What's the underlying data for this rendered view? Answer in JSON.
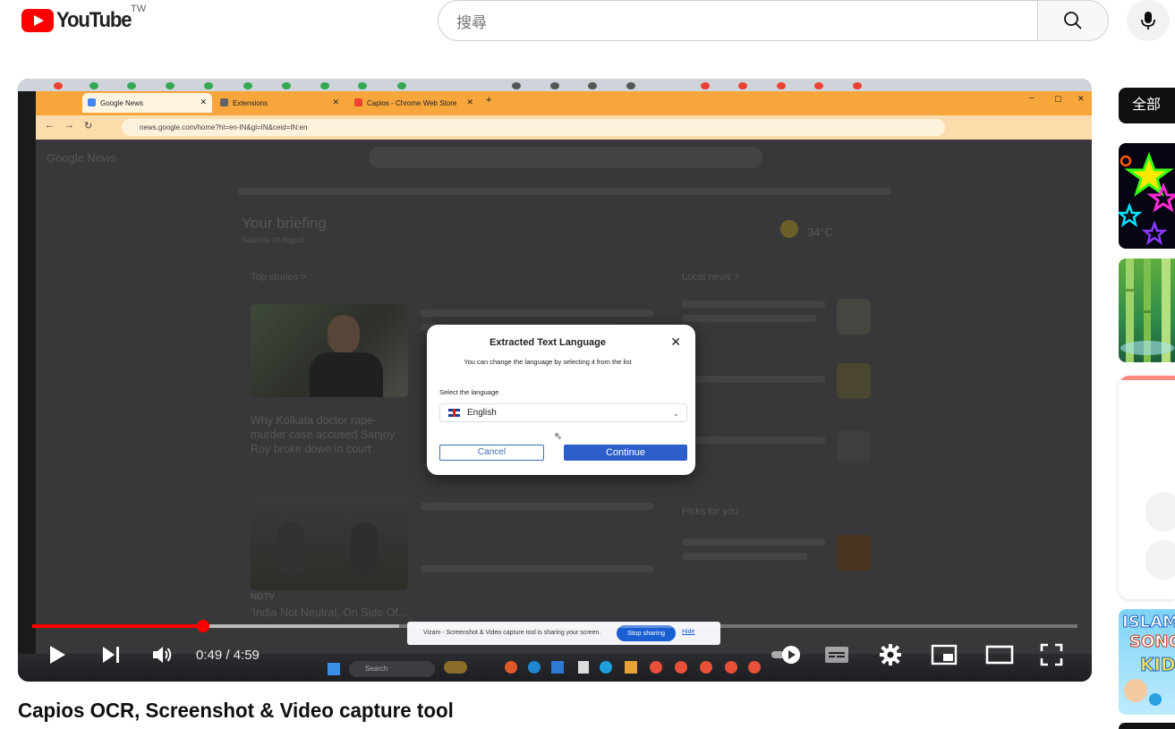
{
  "header": {
    "logo_word": "YouTube",
    "region": "TW",
    "search_placeholder": "搜尋"
  },
  "player": {
    "current_time": "0:49",
    "duration": "4:59",
    "time_separator": " / ",
    "progress_fraction": 0.1637,
    "time_display": "0:49 / 4:59"
  },
  "recording": {
    "tabs": [
      {
        "label": "Google News"
      },
      {
        "label": "Extensions"
      },
      {
        "label": "Capios - Chrome Web Store"
      }
    ],
    "address": "news.google.com/home?hl=en-IN&gl=IN&ceid=IN:en",
    "site_logo": "Google News",
    "briefing_title": "Your briefing",
    "briefing_date": "Saturday 24 August",
    "top_stories": "Top stories >",
    "local_news": "Local news >",
    "picks_for_you": "Picks for you",
    "weather_temp": "34°C",
    "story_1": "Why Kolkata doctor rape-murder case accused Sanjoy Roy broke down in court",
    "story_2_source": "NDTV",
    "story_2": "'India Not Neutral, On Side Of...",
    "modal": {
      "title": "Extracted Text Language",
      "subtitle": "You can change the language by selecting it from the list",
      "select_label": "Select the language",
      "selected_language": "English",
      "cancel": "Cancel",
      "continue": "Continue"
    },
    "sharebar": {
      "message": "Vizam - Screenshot & Video capture tool is sharing your screen.",
      "stop": "Stop sharing",
      "hide": "Hide"
    },
    "taskbar_search": "Search"
  },
  "video": {
    "title": "Capios OCR, Screenshot & Video capture tool"
  },
  "sidebar": {
    "chip_all": "全部",
    "thumb_text_1": "ISLAM",
    "thumb_text_2": "SONG",
    "thumb_text_3": "KID"
  },
  "colors": {
    "youtube_red": "#ff0000",
    "browser_orange": "#f7a63c",
    "continue_blue": "#2c5fc9"
  }
}
